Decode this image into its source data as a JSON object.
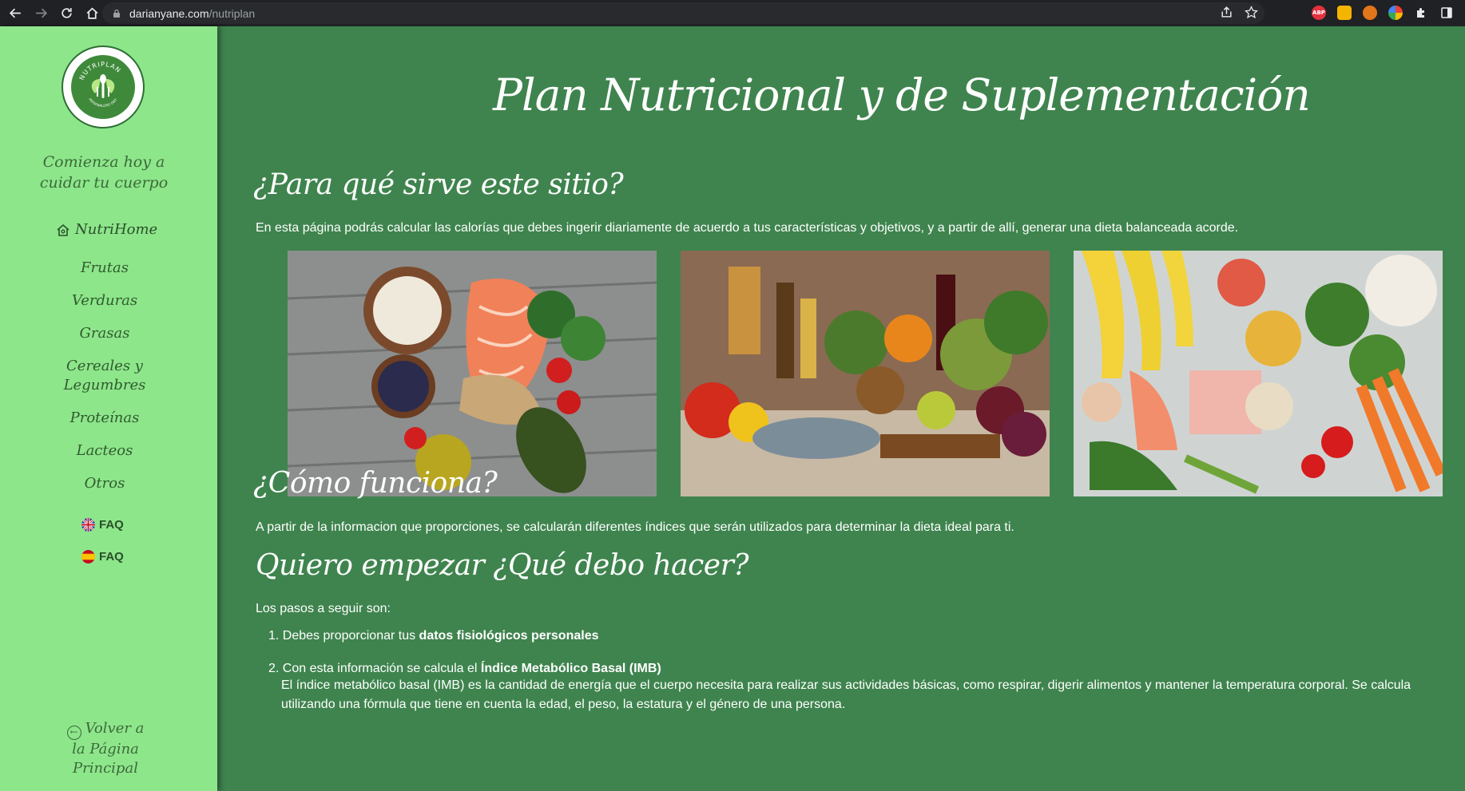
{
  "browser": {
    "url_domain": "darianyane.com",
    "url_path": "/nutriplan",
    "ext_abp": "ABP"
  },
  "sidebar": {
    "logo_text": "NUTRIPLAN",
    "logo_subtext": "PERSONALIZED DIET",
    "tagline_line1": "Comienza hoy a",
    "tagline_line2": "cuidar tu cuerpo",
    "home_label": "NutriHome",
    "items": [
      {
        "label": "Frutas"
      },
      {
        "label": "Verduras"
      },
      {
        "label": "Grasas"
      },
      {
        "label": "Cereales y"
      },
      {
        "label": "Legumbres"
      },
      {
        "label": "Proteínas"
      },
      {
        "label": "Lacteos"
      },
      {
        "label": "Otros"
      }
    ],
    "faq_en": "FAQ",
    "faq_es": "FAQ",
    "back_line1": "Volver a",
    "back_line2": "la Página",
    "back_line3": "Principal"
  },
  "main": {
    "title": "Plan Nutricional y de Suplementación",
    "section1_heading": "¿Para qué sirve este sitio?",
    "section1_text": "En esta página podrás calcular las calorías que debes ingerir diariamente de acuerdo a tus características y objetivos, y a partir de allí, generar una dieta balanceada acorde.",
    "section2_heading": "¿Cómo funciona?",
    "section2_text": "A partir de la informacion que proporciones, se calcularán diferentes índices que serán utilizados para determinar la dieta ideal para ti.",
    "section3_heading": "Quiero empezar ¿Qué debo hacer?",
    "section3_intro": "Los pasos a seguir son:",
    "step1_prefix": "1. Debes proporcionar tus ",
    "step1_bold": "datos fisiológicos personales",
    "step2_prefix": "2. Con esta información se calcula el ",
    "step2_bold": "Índice Metabólico Basal (IMB)",
    "step2_detail": "El índice metabólico basal (IMB) es la cantidad de energía que el cuerpo necesita para realizar sus actividades básicas, como respirar, digerir alimentos y mantener la temperatura corporal. Se calcula utilizando una fórmula que tiene en cuenta la edad, el peso, la estatura y el género de una persona."
  },
  "colors": {
    "main_bg": "#3f844e",
    "sidebar_bg": "#8ee68b",
    "chrome_bg": "#202124"
  }
}
